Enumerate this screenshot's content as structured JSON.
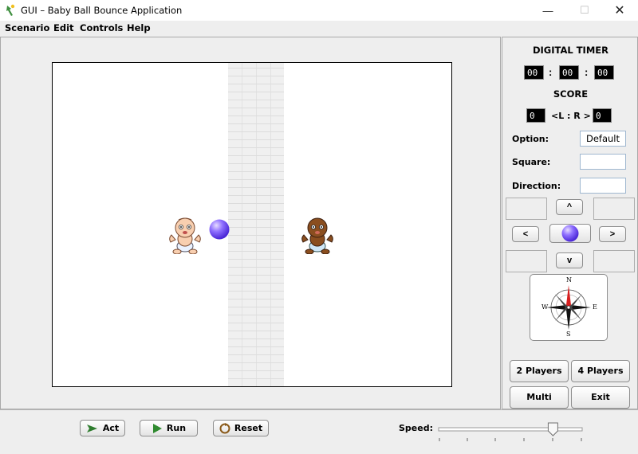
{
  "window": {
    "title": "GUI – Baby Ball Bounce Application",
    "min_glyph": "—",
    "max_glyph": "☐",
    "close_glyph": "✕"
  },
  "menu": [
    "Scenario",
    "Edit",
    "Controls",
    "Help"
  ],
  "side": {
    "timer_label": "DIGITAL TIMER",
    "timer": {
      "hours": "00",
      "minutes": "00",
      "seconds": "00",
      "sep": ":"
    },
    "score_label": "SCORE",
    "score": {
      "left": "0",
      "right": "0",
      "sep": "<L : R >"
    },
    "option_label": "Option:",
    "option_value": "Default",
    "square_label": "Square:",
    "square_value": "",
    "direction_label": "Direction:",
    "direction_value": "",
    "up_label": "^",
    "down_label": "v",
    "left_label": "<",
    "right_label": ">",
    "compass": {
      "n": "N",
      "s": "S",
      "e": "E",
      "w": "W"
    },
    "btn_2players": "2 Players",
    "btn_4players": "4 Players",
    "btn_multi": "Multi",
    "btn_exit": "Exit"
  },
  "bottom": {
    "act_label": "Act",
    "run_label": "Run",
    "reset_label": "Reset",
    "speed_label": "Speed:",
    "speed_value": 0.8
  },
  "colors": {
    "ball": "#7b5cff",
    "lcd_bg": "#000000",
    "lcd_fg": "#ffffff"
  },
  "icons": [
    "baby-light-icon",
    "baby-dark-icon",
    "ball-icon",
    "compass-icon",
    "act-arrow-icon",
    "run-play-icon",
    "reset-icon"
  ]
}
